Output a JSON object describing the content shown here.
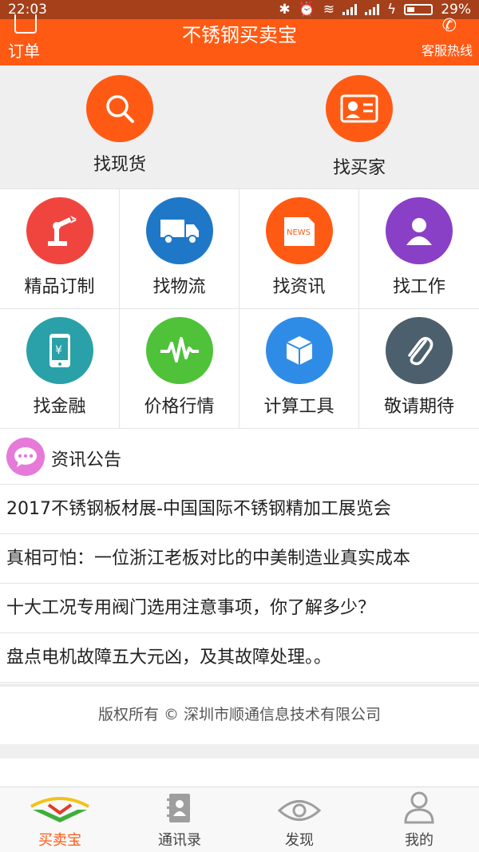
{
  "status_bar": {
    "time": "22:03",
    "battery": "29%"
  },
  "header": {
    "title": "不锈钢买卖宝",
    "left_label": "订单",
    "right_label": "客服热线"
  },
  "hero": [
    {
      "label": "找现货",
      "icon": "search-icon"
    },
    {
      "label": "找买家",
      "icon": "id-card-icon"
    }
  ],
  "grid": [
    {
      "label": "精品订制",
      "icon": "robot-arm-icon",
      "color": "#f0453f"
    },
    {
      "label": "找物流",
      "icon": "truck-icon",
      "color": "#1f78c7"
    },
    {
      "label": "找资讯",
      "icon": "news-icon",
      "color": "#ff5a14"
    },
    {
      "label": "找工作",
      "icon": "person-icon",
      "color": "#8a3fc7"
    },
    {
      "label": "找金融",
      "icon": "phone-yen-icon",
      "color": "#2aa1a8"
    },
    {
      "label": "价格行情",
      "icon": "pulse-icon",
      "color": "#4fc23a"
    },
    {
      "label": "计算工具",
      "icon": "box-icon",
      "color": "#2f8ce6"
    },
    {
      "label": "敬请期待",
      "icon": "paperclip-icon",
      "color": "#4c5f6d"
    }
  ],
  "news": {
    "title": "资讯公告",
    "items": [
      "2017不锈钢板材展-中国国际不锈钢精加工展览会",
      "真相可怕：一位浙江老板对比的中美制造业真实成本",
      "十大工况专用阀门选用注意事项，你了解多少？",
      "盘点电机故障五大元凶，及其故障处理。。"
    ]
  },
  "footer": {
    "copyright": "版权所有 © 深圳市顺通信息技术有限公司"
  },
  "tabs": [
    {
      "label": "买卖宝",
      "icon": "brand-logo-icon",
      "active": true
    },
    {
      "label": "通讯录",
      "icon": "contacts-book-icon",
      "active": false
    },
    {
      "label": "发现",
      "icon": "eye-icon",
      "active": false
    },
    {
      "label": "我的",
      "icon": "user-icon",
      "active": false
    }
  ],
  "colors": {
    "accent": "#ff5a14",
    "status_bar": "#a5401a",
    "news_badge": "#e57ad9"
  }
}
